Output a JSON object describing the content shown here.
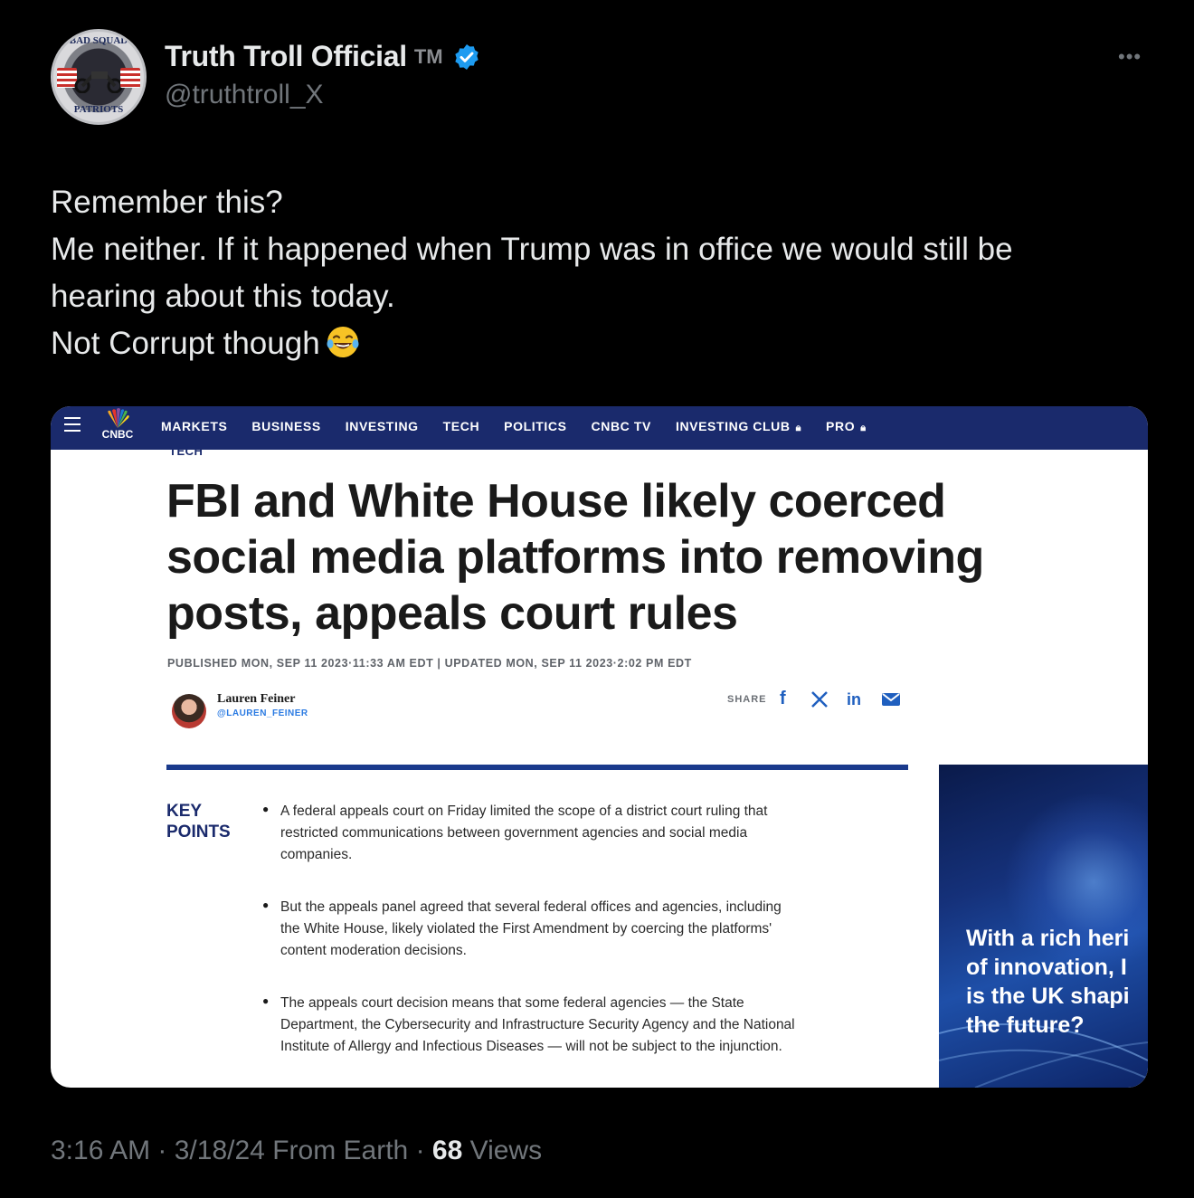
{
  "author": {
    "display_name": "Truth Troll Official",
    "tm": "TM",
    "handle": "@truthtroll_X",
    "avatar_text_top": "BAD SQUAD",
    "avatar_text_bottom": "PATRIOTS",
    "verified_color": "#1d9bf0"
  },
  "tweet": {
    "lines": [
      "Remember this?",
      "Me neither. If it happened when Trump was in office we would still be",
      "hearing about this today.",
      "Not Corrupt though"
    ],
    "emoji": "face-with-tears-of-joy"
  },
  "article": {
    "nav": {
      "logo": "CNBC",
      "items": [
        "MARKETS",
        "BUSINESS",
        "INVESTING",
        "TECH",
        "POLITICS",
        "CNBC TV",
        "INVESTING CLUB",
        "PRO"
      ],
      "nav_color": "#1a2a6c"
    },
    "section": "TECH",
    "headline": [
      "FBI and White House likely coerced",
      "social media platforms into removing",
      "posts, appeals court rules"
    ],
    "dateline": "PUBLISHED MON, SEP 11 2023·11:33 AM EDT | UPDATED MON, SEP 11 2023·2:02 PM EDT",
    "author_name": "Lauren Feiner",
    "author_handle": "@LAUREN_FEINER",
    "share_label": "SHARE",
    "share_icons": [
      "facebook-icon",
      "x-icon",
      "linkedin-icon",
      "email-icon"
    ],
    "key_points_label": [
      "KEY",
      "POINTS"
    ],
    "key_points": [
      [
        "A federal appeals court on Friday limited the scope of a district court ruling that",
        "restricted communications between government agencies and social media",
        "companies."
      ],
      [
        "But the appeals panel agreed that several federal offices and agencies, including",
        "the White House, likely violated the First Amendment by coercing the platforms'",
        "content moderation decisions."
      ],
      [
        "The appeals court decision means that some federal agencies — the State",
        "Department, the Cybersecurity and Infrastructure Security Agency and the National",
        "Institute of Allergy and Infectious Diseases — will not be subject to the injunction."
      ]
    ],
    "ad_lines": [
      "With a rich heri",
      "of innovation, I",
      "is the UK shapi",
      "the future?"
    ]
  },
  "footer": {
    "time": "3:16 AM",
    "date": "3/18/24",
    "source": "From Earth",
    "views_count": "68",
    "views_label": "Views"
  }
}
